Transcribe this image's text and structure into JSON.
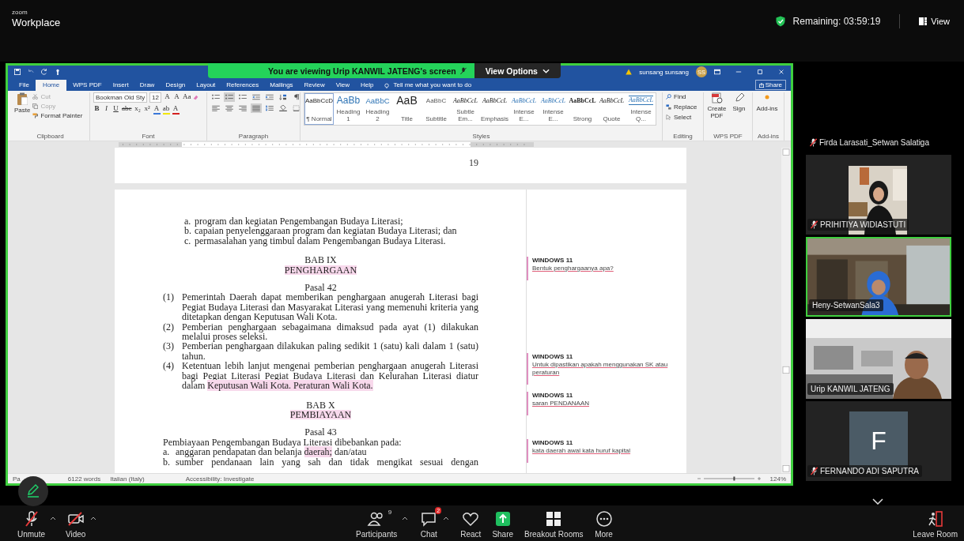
{
  "top_bar": {
    "brand_small": "zoom",
    "brand": "Workplace",
    "remaining": "Remaining: 03:59:19",
    "view": "View"
  },
  "share_banner": {
    "text": "You are viewing  Urip KANWIL JATENG's screen",
    "view_options": "View Options"
  },
  "word": {
    "account": "sunsang sunsang",
    "avatar": "SS",
    "share": "Share",
    "tabs": [
      {
        "label": "File",
        "selected": false
      },
      {
        "label": "Home",
        "selected": true
      },
      {
        "label": "WPS PDF",
        "selected": false
      },
      {
        "label": "Insert",
        "selected": false
      },
      {
        "label": "Draw",
        "selected": false
      },
      {
        "label": "Design",
        "selected": false
      },
      {
        "label": "Layout",
        "selected": false
      },
      {
        "label": "References",
        "selected": false
      },
      {
        "label": "Mailings",
        "selected": false
      },
      {
        "label": "Review",
        "selected": false
      },
      {
        "label": "View",
        "selected": false
      },
      {
        "label": "Help",
        "selected": false
      }
    ],
    "tell_me": "Tell me what you want to do",
    "ribbon": {
      "clipboard": {
        "paste": "Paste",
        "label": "Clipboard",
        "items": [
          {
            "label": "Cut",
            "kind": "cut",
            "disabled": true
          },
          {
            "label": "Copy",
            "kind": "copy",
            "disabled": true
          },
          {
            "label": "Format Painter",
            "kind": "painter",
            "disabled": false
          }
        ]
      },
      "font": {
        "family": "Bookman Old Sty",
        "size": "12",
        "label": "Font",
        "row1": [
          "A",
          "A",
          "Aa"
        ],
        "row2": [
          {
            "label": "B",
            "kind": "bold"
          },
          {
            "label": "I",
            "kind": "italic"
          },
          {
            "label": "U",
            "kind": "underline"
          },
          {
            "label": "abc",
            "kind": "strike"
          },
          {
            "label": "x₂",
            "kind": "plain"
          },
          {
            "label": "x²",
            "kind": "plain"
          },
          {
            "label": "A",
            "kind": "color",
            "color": "#3a78d8"
          },
          {
            "label": "ab",
            "kind": "color",
            "color": "#f2e600"
          },
          {
            "label": "A",
            "kind": "color",
            "color": "#d42020"
          }
        ]
      },
      "paragraph": {
        "label": "Paragraph",
        "rows": [
          [
            {
              "kind": "bullets",
              "selected": false
            },
            {
              "kind": "numbering",
              "selected": true
            },
            {
              "kind": "multilevel",
              "selected": false
            },
            {
              "kind": "outdent",
              "selected": false
            },
            {
              "kind": "indent",
              "selected": false
            },
            {
              "kind": "sort",
              "selected": false
            },
            {
              "kind": "pilcrow",
              "selected": false
            }
          ],
          [
            {
              "kind": "align-left",
              "selected": false
            },
            {
              "kind": "align-center",
              "selected": false
            },
            {
              "kind": "align-right",
              "selected": false
            },
            {
              "kind": "justify",
              "selected": true
            },
            {
              "kind": "spacing",
              "selected": false
            },
            {
              "kind": "shading",
              "selected": false
            },
            {
              "kind": "borders",
              "selected": false
            }
          ]
        ]
      },
      "styles": {
        "label": "Styles",
        "items": [
          {
            "sample": "AaBbCcD",
            "name": "¶ Normal",
            "kind": "plain",
            "selected": true
          },
          {
            "sample": "AaBb",
            "name": "Heading 1",
            "kind": "heading1",
            "selected": false
          },
          {
            "sample": "AaBbC",
            "name": "Heading 2",
            "kind": "heading2",
            "selected": false
          },
          {
            "sample": "AaB",
            "name": "Title",
            "kind": "title",
            "selected": false
          },
          {
            "sample": "AaBbC",
            "name": "Subtitle",
            "kind": "subtitle",
            "selected": false
          },
          {
            "sample": "AaBbCcL",
            "name": "Subtle Em...",
            "kind": "italic",
            "selected": false
          },
          {
            "sample": "AaBbCcL",
            "name": "Emphasis",
            "kind": "italic",
            "selected": false
          },
          {
            "sample": "AaBbCcL",
            "name": "Intense E...",
            "kind": "intense",
            "selected": false
          },
          {
            "sample": "AaBbCcL",
            "name": "Intense E...",
            "kind": "intense",
            "selected": false
          },
          {
            "sample": "AaBbCcL",
            "name": "Strong",
            "kind": "strong",
            "selected": false
          },
          {
            "sample": "AaBbCcL",
            "name": "Quote",
            "kind": "italic",
            "selected": false
          },
          {
            "sample": "AaBbCcL",
            "name": "Intense Q...",
            "kind": "quote",
            "selected": false
          }
        ]
      },
      "editing": {
        "find": "Find",
        "replace": "Replace",
        "select": "Select",
        "label": "Editing"
      },
      "wps_pdf": {
        "create": "Create PDF",
        "sign": "Sign",
        "label": "WPS PDF"
      },
      "add_ins": {
        "button": "Add-ins",
        "label": "Add-ins"
      }
    },
    "document": {
      "page_number": "19",
      "blocks": [
        {
          "kind": "list",
          "items": [
            {
              "marker": "a.",
              "segments": [
                {
                  "text": "program dan kegiatan Pengembangan Budaya Literasi;",
                  "highlight": false
                }
              ]
            },
            {
              "marker": "b.",
              "segments": [
                {
                  "text": "capaian penyelenggaraan program dan kegiatan Budaya Literasi; dan",
                  "highlight": false
                }
              ]
            },
            {
              "marker": "c.",
              "segments": [
                {
                  "text": "permasalahan yang timbul dalam Pengembangan Budaya Literasi.",
                  "highlight": false
                }
              ]
            }
          ]
        },
        {
          "kind": "chapter",
          "lines": [
            {
              "text": "BAB IX",
              "highlight": false
            },
            {
              "text": "PENGHARGAAN",
              "highlight": true
            }
          ]
        },
        {
          "kind": "article",
          "lines": [
            {
              "text": "Pasal 42",
              "highlight": false
            }
          ]
        },
        {
          "kind": "numbered",
          "items": [
            {
              "marker": "(1)",
              "segments": [
                {
                  "text": "Pemerintah Daerah dapat memberikan penghargaan anugerah Literasi bagi Pegiat Budaya Literasi dan Masyarakat Literasi yang memenuhi kriteria yang ditetapkan dengan Keputusan Wali Kota.",
                  "highlight": false
                }
              ]
            },
            {
              "marker": "(2)",
              "segments": [
                {
                  "text": "Pemberian penghargaan sebagaimana dimaksud pada ayat (1) dilakukan melalui proses seleksi.",
                  "highlight": false
                }
              ]
            },
            {
              "marker": "(3)",
              "segments": [
                {
                  "text": "Pemberian penghargaan dilakukan paling sedikit 1 (satu) kali dalam 1 (satu) tahun.",
                  "highlight": false
                }
              ]
            },
            {
              "marker": "(4)",
              "segments": [
                {
                  "text": "Ketentuan lebih lanjut mengenai pemberian penghargaan anugerah Literasi bagi Pegiat Literasi Pegiat Budaya Literasi dan Kelurahan Literasi diatur dalam ",
                  "highlight": false
                },
                {
                  "text": "Keputusan Wali Kota. Peraturan Wali Kota.",
                  "highlight": true
                }
              ]
            }
          ]
        },
        {
          "kind": "chapter",
          "lines": [
            {
              "text": "BAB X",
              "highlight": false
            },
            {
              "text": "PEMBIAYAAN",
              "highlight": true
            }
          ]
        },
        {
          "kind": "article",
          "lines": [
            {
              "text": "Pasal 43",
              "highlight": false
            }
          ]
        },
        {
          "kind": "paragraph",
          "segments": [
            {
              "text": "Pembiayaan Pengembangan Budaya Literasi dibebankan pada:",
              "highlight": false
            }
          ]
        },
        {
          "kind": "sublist",
          "items": [
            {
              "marker": "a.",
              "segments": [
                {
                  "text": "anggaran pendapatan dan belanja ",
                  "highlight": false
                },
                {
                  "text": "daerah;",
                  "highlight": true
                },
                {
                  "text": " dan/atau",
                  "highlight": false
                }
              ]
            },
            {
              "marker": "b.",
              "segments": [
                {
                  "text": "sumber pendanaan lain yang sah dan tidak mengikat sesuai dengan",
                  "highlight": false
                }
              ]
            }
          ]
        }
      ],
      "comments": [
        {
          "author": "WINDOWS 11",
          "text": "Bentuk penghargaanya apa?"
        },
        {
          "author": "WINDOWS 11",
          "text": "Untuk dipastikan apakah menggunakan SK atau peraturan"
        },
        {
          "author": "WINDOWS 11",
          "text": "saran PENDANAAN"
        },
        {
          "author": "WINDOWS 11",
          "text": "kata daerah awal kata huruf kapital"
        }
      ]
    },
    "status": {
      "page": "Pa",
      "words": "6122 words",
      "zoom_slider": {
        "level": 0.6
      },
      "language": "Italian (Italy)",
      "accessibility": "Accessibility: Investigate",
      "zoom": "124%"
    }
  },
  "participants": [
    {
      "name": "Firda Larasati_Setwan Salatiga",
      "muted": true,
      "kind": "name_only",
      "speaking": false
    },
    {
      "name": "PRIHITIYA WIDIASTUTI",
      "muted": true,
      "kind": "small_video",
      "speaking": false
    },
    {
      "name": "Heny-SetwanSala3",
      "muted": false,
      "kind": "video",
      "speaking": true
    },
    {
      "name": "Urip KANWIL JATENG",
      "muted": false,
      "kind": "video2",
      "speaking": false
    },
    {
      "name": "FERNANDO ADI SAPUTRA",
      "muted": true,
      "kind": "avatar",
      "initial": "F",
      "speaking": false
    }
  ],
  "toolbar": {
    "items": [
      {
        "label": "Unmute",
        "kind": "mic",
        "caret": true
      },
      {
        "label": "Video",
        "kind": "video",
        "caret": true
      }
    ],
    "center": [
      {
        "label": "Participants",
        "kind": "participants",
        "count": "9",
        "caret": true
      },
      {
        "label": "Chat",
        "kind": "chat",
        "badge": "2",
        "caret": true
      },
      {
        "label": "React",
        "kind": "react",
        "caret": false
      },
      {
        "label": "Share",
        "kind": "share",
        "caret": false
      },
      {
        "label": "Breakout Rooms",
        "kind": "breakout",
        "caret": false
      },
      {
        "label": "More",
        "kind": "more",
        "caret": false
      }
    ],
    "leave": "Leave Room"
  }
}
